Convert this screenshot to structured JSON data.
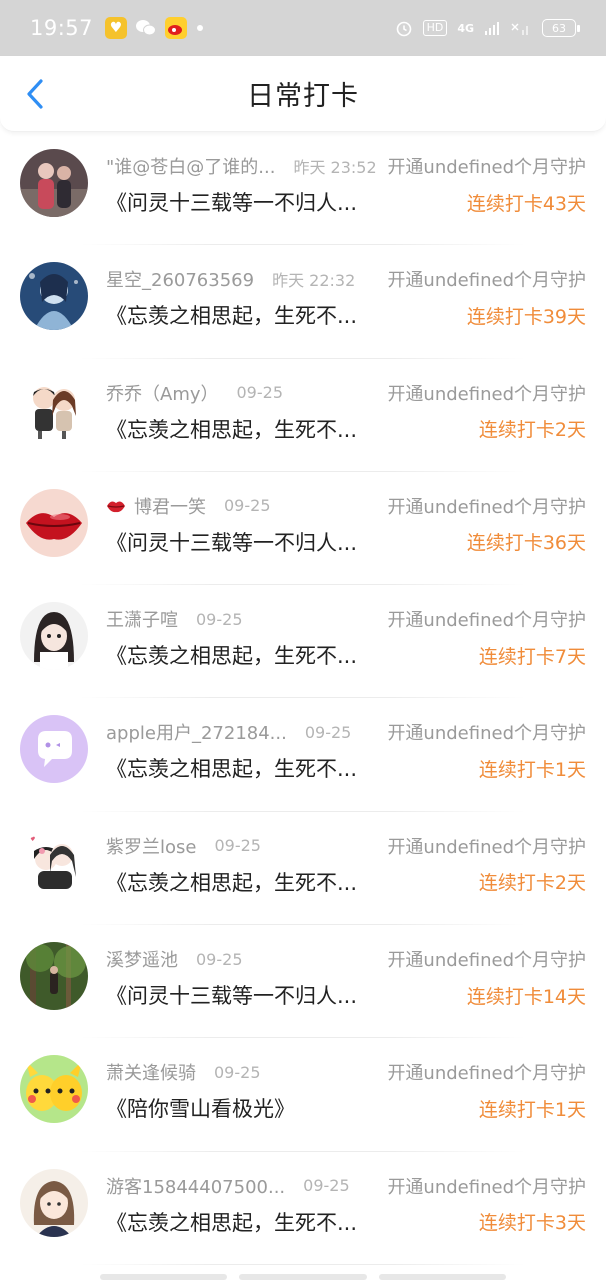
{
  "status_bar": {
    "time": "19:57",
    "icons": [
      "app-icon",
      "wechat-icon",
      "weibo-icon",
      "notification-dot"
    ],
    "right": {
      "alarm": "alarm-icon",
      "hd": "HD",
      "network": "4G",
      "battery": "63"
    }
  },
  "header": {
    "title": "日常打卡",
    "back_icon": "back-chevron-icon",
    "accent": "#2f8ef4"
  },
  "colors": {
    "streak": "#f08c3a",
    "muted": "#9a9a9a",
    "text": "#222222"
  },
  "items": [
    {
      "name": "\"谁@苍白@了谁的...",
      "time": "昨天 23:52",
      "message": "《问灵十三载等一不归人...",
      "sub": "开通undefined个月守护",
      "streak": "连续打卡43天",
      "avatar": "avatar-photo-couple"
    },
    {
      "name": "星空_260763569",
      "time": "昨天 22:32",
      "message": "《忘羡之相思起，生死不...",
      "sub": "开通undefined个月守护",
      "streak": "连续打卡39天",
      "avatar": "avatar-anime-blue"
    },
    {
      "name": "乔乔（Amy）",
      "time": "09-25",
      "message": "《忘羡之相思起，生死不...",
      "sub": "开通undefined个月守护",
      "streak": "连续打卡2天",
      "avatar": "avatar-cartoon-couple"
    },
    {
      "name": "博君一笑",
      "time": "09-25",
      "message": "《问灵十三载等一不归人...",
      "sub": "开通undefined个月守护",
      "streak": "连续打卡36天",
      "avatar": "avatar-red-lips",
      "prefix_icon": "lips-icon"
    },
    {
      "name": "王潇子喧",
      "time": "09-25",
      "message": "《忘羡之相思起，生死不...",
      "sub": "开通undefined个月守护",
      "streak": "连续打卡7天",
      "avatar": "avatar-anime-girl"
    },
    {
      "name": "apple用户_272184...",
      "time": "09-25",
      "message": "《忘羡之相思起，生死不...",
      "sub": "开通undefined个月守护",
      "streak": "连续打卡1天",
      "avatar": "avatar-purple-chat"
    },
    {
      "name": "紫罗兰lose",
      "time": "09-25",
      "message": "《忘羡之相思起，生死不...",
      "sub": "开通undefined个月守护",
      "streak": "连续打卡2天",
      "avatar": "avatar-anime-pair"
    },
    {
      "name": "溪梦遥池",
      "time": "09-25",
      "message": "《问灵十三载等一不归人...",
      "sub": "开通undefined个月守护",
      "streak": "连续打卡14天",
      "avatar": "avatar-forest"
    },
    {
      "name": "萧关逢候骑",
      "time": "09-25",
      "message": "《陪你雪山看极光》",
      "sub": "开通undefined个月守护",
      "streak": "连续打卡1天",
      "avatar": "avatar-pikachu"
    },
    {
      "name": "游客15844407500...",
      "time": "09-25",
      "message": "《忘羡之相思起，生死不...",
      "sub": "开通undefined个月守护",
      "streak": "连续打卡3天",
      "avatar": "avatar-cartoon-girl"
    }
  ]
}
